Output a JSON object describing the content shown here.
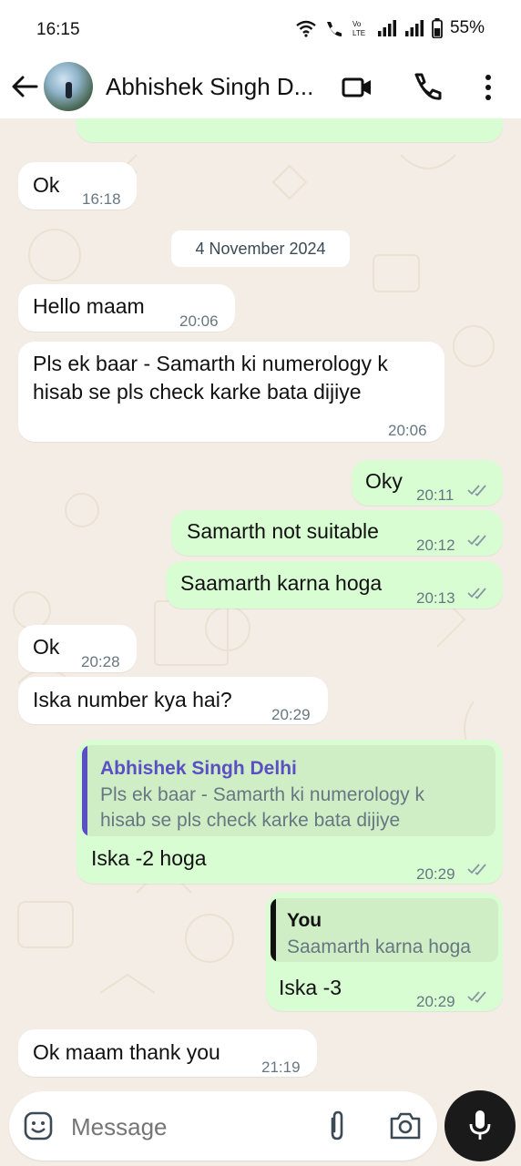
{
  "status_bar": {
    "time": "16:15",
    "battery": "55%"
  },
  "header": {
    "contact_name": "Abhishek Singh D..."
  },
  "messages": [
    {
      "text": "Ok",
      "time": "16:18"
    },
    {
      "date_divider": "4 November 2024"
    },
    {
      "text": "Hello maam",
      "time": "20:06"
    },
    {
      "line1": "Pls ek baar - Samarth ki numerology k",
      "line2": "hisab se pls check karke bata dijiye",
      "time": "20:06"
    },
    {
      "text": "Oky",
      "time": "20:11"
    },
    {
      "text": "Samarth not suitable",
      "time": "20:12"
    },
    {
      "text": "Saamarth karna hoga",
      "time": "20:13"
    },
    {
      "text": "Ok",
      "time": "20:28"
    },
    {
      "text": "Iska number kya hai?",
      "time": "20:29"
    },
    {
      "quote_author": "Abhishek Singh Delhi",
      "quote_line1": "Pls ek baar - Samarth ki numerology k",
      "quote_line2": "hisab se pls check karke bata dijiye",
      "text": "Iska -2 hoga",
      "time": "20:29"
    },
    {
      "quote_author": "You",
      "quote_line1": "Saamarth karna hoga",
      "text": "Iska -3",
      "time": "20:29"
    },
    {
      "text": "Ok maam thank you",
      "time": "21:19"
    }
  ],
  "input": {
    "placeholder": "Message"
  },
  "colors": {
    "outgoing": "#d9fdd3",
    "incoming": "#ffffff",
    "quote_bar_contact": "#5b4fc4",
    "quote_bar_self": "#111111"
  },
  "icons": [
    "back-arrow-icon",
    "video-call-icon",
    "phone-icon",
    "more-options-icon",
    "emoji-icon",
    "attach-icon",
    "camera-icon",
    "mic-icon",
    "read-ticks-icon"
  ]
}
